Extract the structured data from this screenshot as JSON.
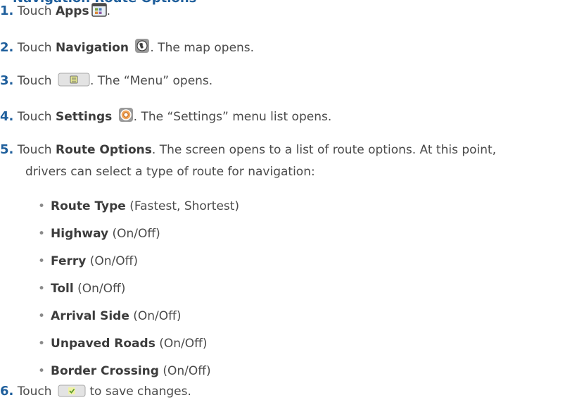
{
  "heading": "Navigation Route Options",
  "touch": "Touch",
  "steps": [
    {
      "num": "1.",
      "bold": "Apps",
      "rest": "."
    },
    {
      "num": "2.",
      "bold": "Navigation",
      "rest": ". The map opens."
    },
    {
      "num": "3.",
      "rest": ". The “Menu” opens."
    },
    {
      "num": "4.",
      "bold": "Settings",
      "rest": ". The “Settings” menu list opens."
    },
    {
      "num": "5.",
      "bold": "Route Options",
      "rest": ". The screen opens to a list of route options. At this point,",
      "cont": "drivers can select a type of route for navigation:"
    },
    {
      "num": "6.",
      "rest": " to save changes."
    }
  ],
  "options": [
    {
      "bold": "Route Type",
      "rest": " (Fastest, Shortest)"
    },
    {
      "bold": "Highway",
      "rest": " (On/Off)"
    },
    {
      "bold": "Ferry",
      "rest": " (On/Off)"
    },
    {
      "bold": "Toll",
      "rest": " (On/Off)"
    },
    {
      "bold": "Arrival Side",
      "rest": " (On/Off)"
    },
    {
      "bold": "Unpaved Roads",
      "rest": " (On/Off)"
    },
    {
      "bold": "Border Crossing",
      "rest": " (On/Off)"
    }
  ],
  "icons": {
    "apps": "apps-icon",
    "navigation": "navigation-globe-icon",
    "menu": "menu-icon",
    "settings": "settings-gear-icon",
    "save": "checkmark-save-icon"
  },
  "colors": {
    "heading_blue": "#1f5f9c",
    "body_text": "#4a4a4a"
  }
}
